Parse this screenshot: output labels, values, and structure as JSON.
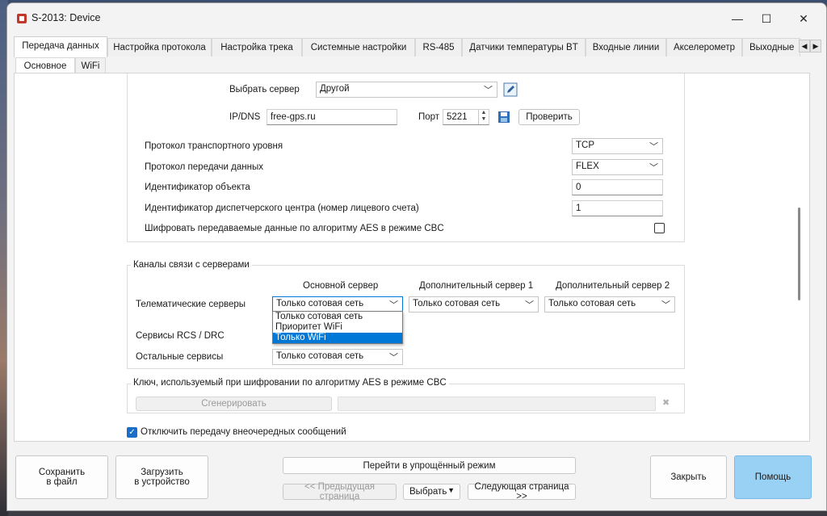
{
  "window": {
    "title": "S-2013: Device",
    "controls": {
      "minimize": "—",
      "maximize": "☐",
      "close": "✕"
    }
  },
  "tabs": [
    "Передача данных",
    "Настройка протокола",
    "Настройка трека",
    "Системные настройки",
    "RS-485",
    "Датчики температуры BT",
    "Входные линии",
    "Акселерометр",
    "Выходные"
  ],
  "subtabs": [
    "Основное",
    "WiFi"
  ],
  "server_section": {
    "choose_server_label": "Выбрать сервер",
    "choose_server_value": "Другой",
    "ipdns_label": "IP/DNS",
    "ipdns_value": "free-gps.ru",
    "port_label": "Порт",
    "port_value": "5221",
    "check_button": "Проверить",
    "transport_label": "Протокол транспортного уровня",
    "transport_value": "TCP",
    "protocol_label": "Протокол передачи данных",
    "protocol_value": "FLEX",
    "object_id_label": "Идентификатор объекта",
    "object_id_value": "0",
    "dispatch_id_label": "Идентификатор диспетчерского центра (номер лицевого счета)",
    "dispatch_id_value": "1",
    "aes_label": "Шифровать передаваемые данные по алгоритму AES в режиме CBC"
  },
  "channels": {
    "title": "Каналы связи с серверами",
    "col_main": "Основной сервер",
    "col_extra1": "Дополнительный сервер 1",
    "col_extra2": "Дополнительный сервер 2",
    "row_telematic": "Телематические серверы",
    "row_rcs": "Сервисы RCS / DRC",
    "row_other": "Остальные сервисы",
    "telematic_main": "Только сотовая сеть",
    "telematic_extra1": "Только сотовая сеть",
    "telematic_extra2": "Только сотовая сеть",
    "other_main": "Только сотовая сеть",
    "dropdown_options": [
      "Только сотовая сеть",
      "Приоритет WiFi",
      "Только WiFi"
    ],
    "dropdown_highlighted": 2
  },
  "aes_key": {
    "title": "Ключ, используемый при шифровании по алгоритму AES в режиме CBC",
    "generate_button": "Сгенерировать",
    "clear_icon": "✖"
  },
  "disable_extra": {
    "label": "Отключить передачу внеочередных сообщений",
    "checked": true
  },
  "footer": {
    "save_file": "Сохранить\nв файл",
    "load_device": "Загрузить\nв устройство",
    "simple_mode": "Перейти в упрощённый режим",
    "prev_page": "<< Предыдущая страница",
    "choose": "Выбрать",
    "next_page": "Следующая страница >>",
    "close": "Закрыть",
    "help": "Помощь"
  },
  "colors": {
    "accent": "#0078d7",
    "help_button": "#99d1f5",
    "check_fill": "#1a6ec8"
  }
}
